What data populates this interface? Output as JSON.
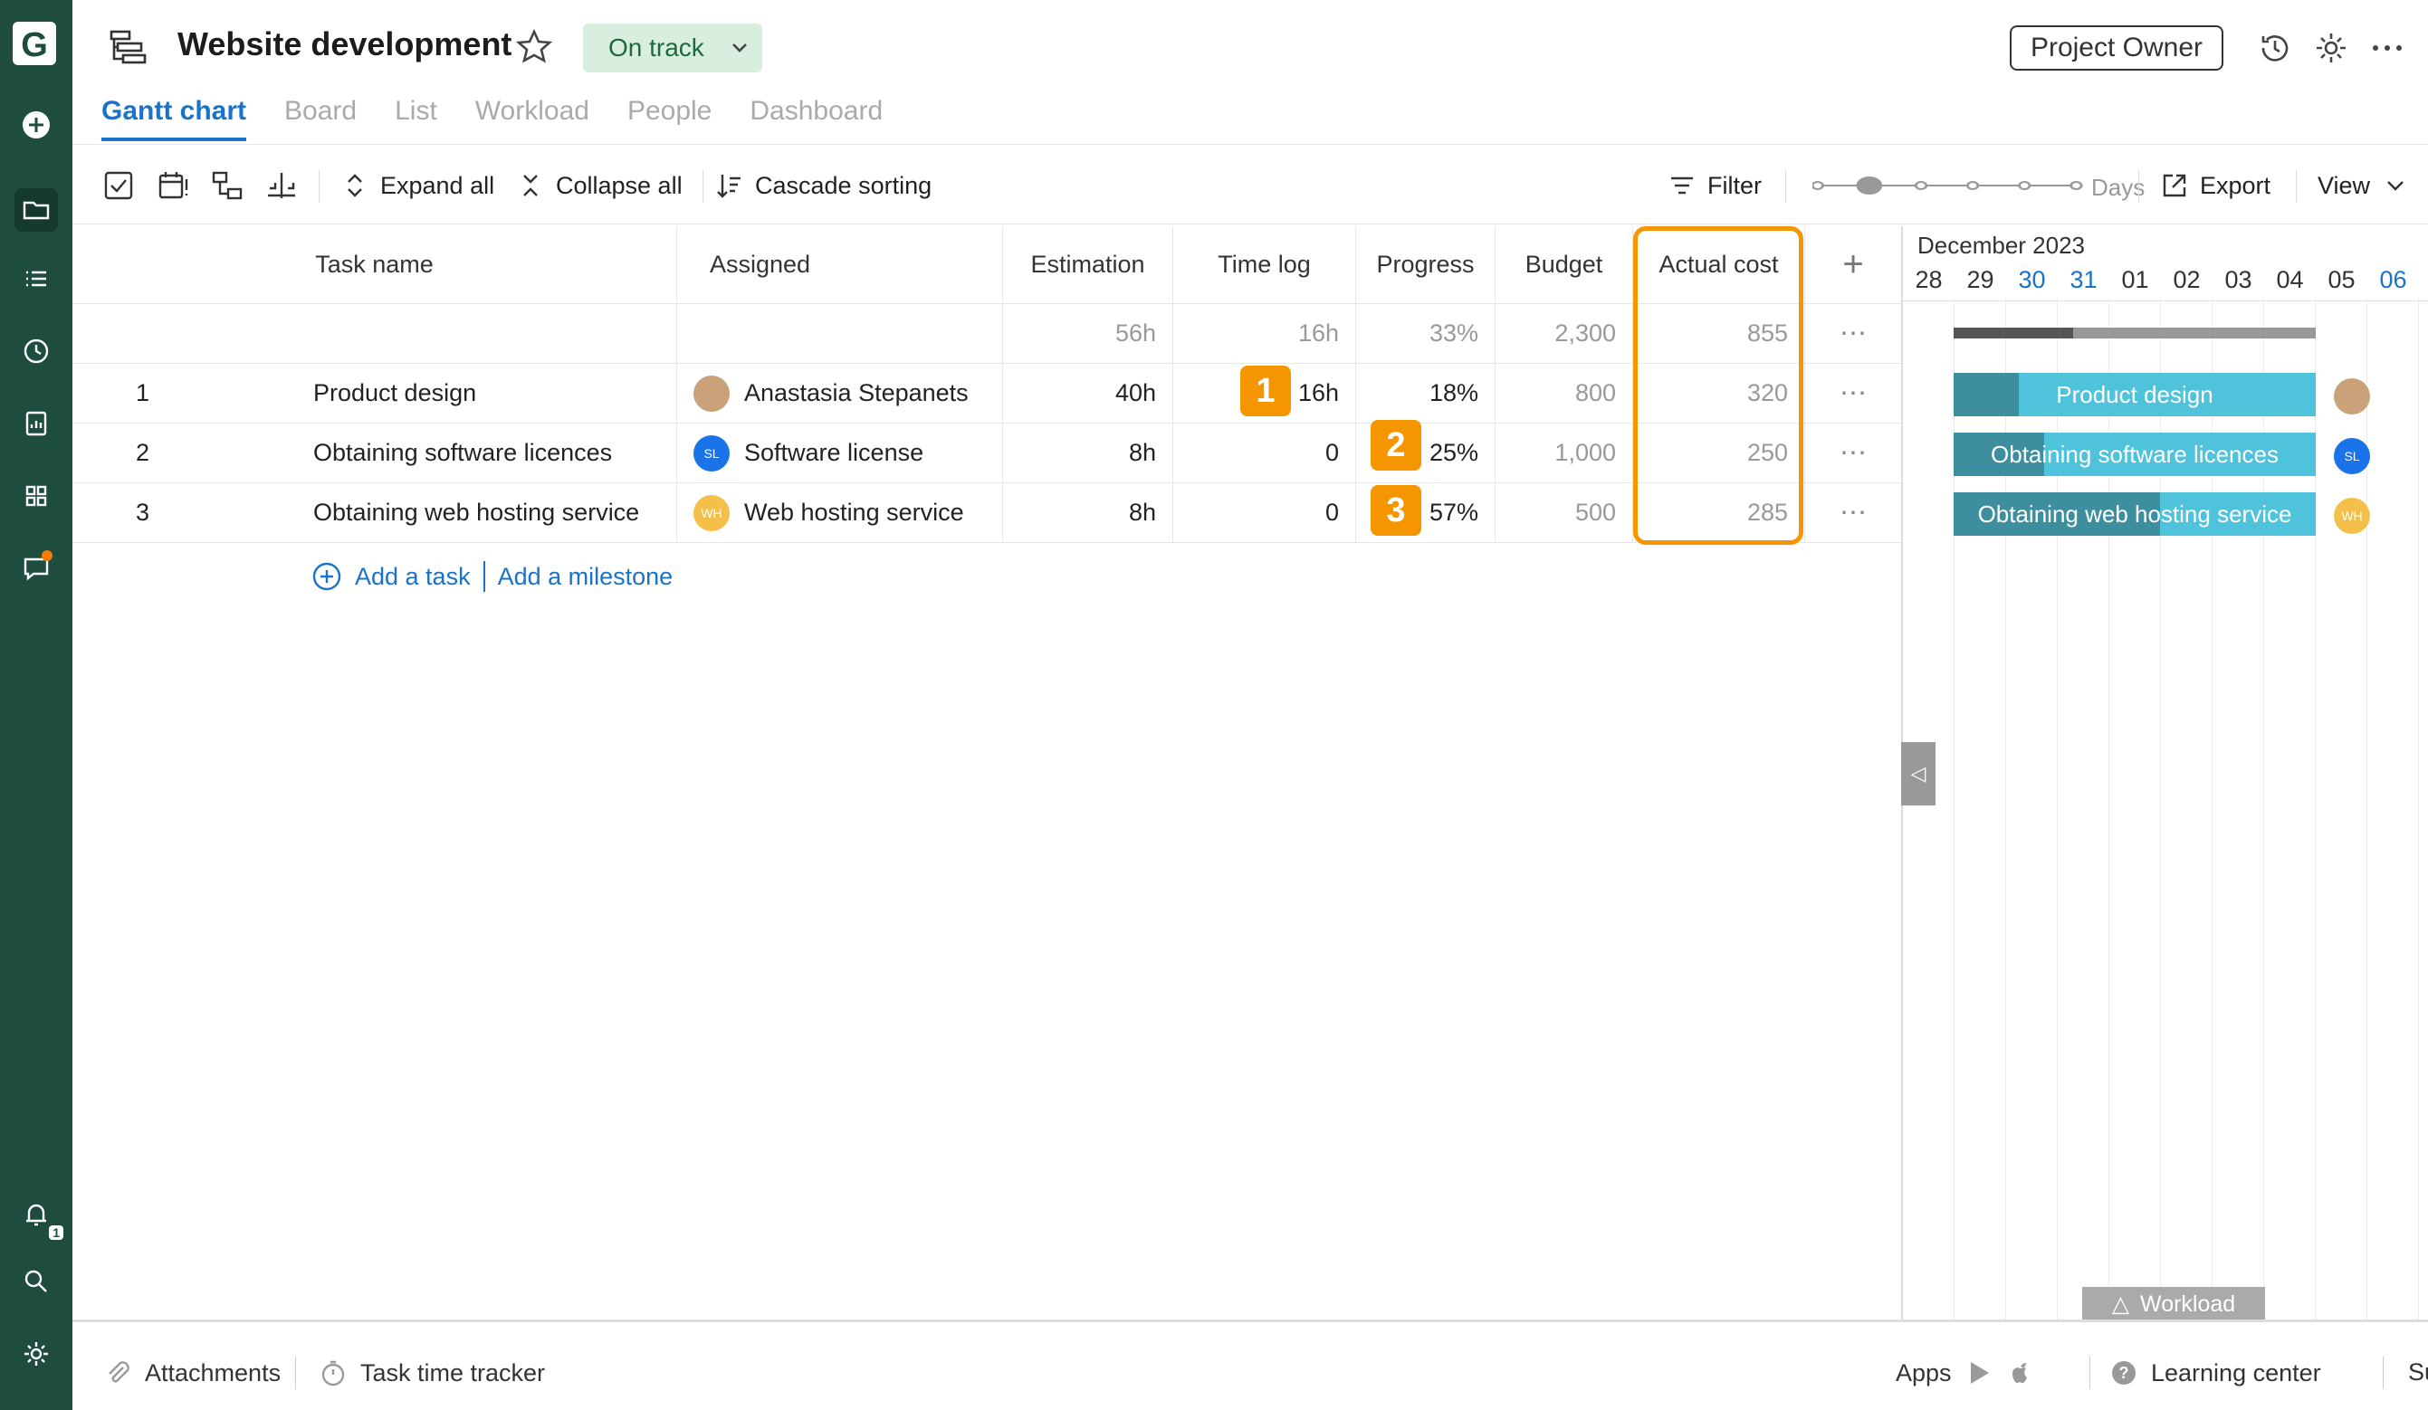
{
  "app": {
    "logo_letter": "G"
  },
  "project": {
    "title": "Website development",
    "status": "On track",
    "owner_button": "Project Owner"
  },
  "tabs": [
    "Gantt chart",
    "Board",
    "List",
    "Workload",
    "People",
    "Dashboard"
  ],
  "toolbar": {
    "expand_all": "Expand all",
    "collapse_all": "Collapse all",
    "cascade_sorting": "Cascade sorting",
    "filter": "Filter",
    "zoom_label": "Days",
    "export": "Export",
    "view": "View"
  },
  "grid": {
    "headers": {
      "task_name": "Task name",
      "assigned": "Assigned",
      "estimation": "Estimation",
      "time_log": "Time log",
      "progress": "Progress",
      "budget": "Budget",
      "actual_cost": "Actual cost"
    },
    "summary": {
      "estimation": "56h",
      "time_log": "16h",
      "progress": "33%",
      "budget": "2,300",
      "actual_cost": "855"
    },
    "rows": [
      {
        "num": "1",
        "name": "Product design",
        "assignee": "Anastasia Stepanets",
        "avatar": "",
        "avatar_color": "#c9a27a",
        "estimation": "40h",
        "time_log": "16h",
        "progress": "18%",
        "budget": "800",
        "actual_cost": "320"
      },
      {
        "num": "2",
        "name": "Obtaining software licences",
        "assignee": "Software license",
        "avatar": "SL",
        "avatar_color": "#1a73e8",
        "estimation": "8h",
        "time_log": "0",
        "progress": "25%",
        "budget": "1,000",
        "actual_cost": "250"
      },
      {
        "num": "3",
        "name": "Obtaining web hosting service",
        "assignee": "Web hosting service",
        "avatar": "WH",
        "avatar_color": "#f5c04a",
        "estimation": "8h",
        "time_log": "0",
        "progress": "57%",
        "budget": "500",
        "actual_cost": "285"
      }
    ],
    "add_task": "Add a task",
    "add_milestone": "Add a milestone",
    "callouts": [
      "1",
      "2",
      "3"
    ]
  },
  "gantt": {
    "month": "December 2023",
    "days": [
      "28",
      "29",
      "30",
      "31",
      "01",
      "02",
      "03",
      "04",
      "05",
      "06"
    ],
    "weekend_days": [
      "30",
      "31",
      "06"
    ],
    "bars": [
      {
        "label": "Product design",
        "progress": 0.18
      },
      {
        "label": "Obtaining software licences",
        "progress": 0.25
      },
      {
        "label": "Obtaining web hosting service",
        "progress": 0.57
      }
    ],
    "summary_progress": 0.33,
    "workload_tab": "Workload"
  },
  "footer": {
    "attachments": "Attachments",
    "task_time_tracker": "Task time tracker",
    "apps": "Apps",
    "learning_center": "Learning center",
    "support": "Support"
  },
  "sidebar": {
    "notification_count": "1"
  },
  "colors": {
    "sidebar": "#1e4d40",
    "accent": "#1a73c9",
    "highlight": "#f59500",
    "bar": "#4fc2dc",
    "bar_progress": "#3d8fa0"
  }
}
